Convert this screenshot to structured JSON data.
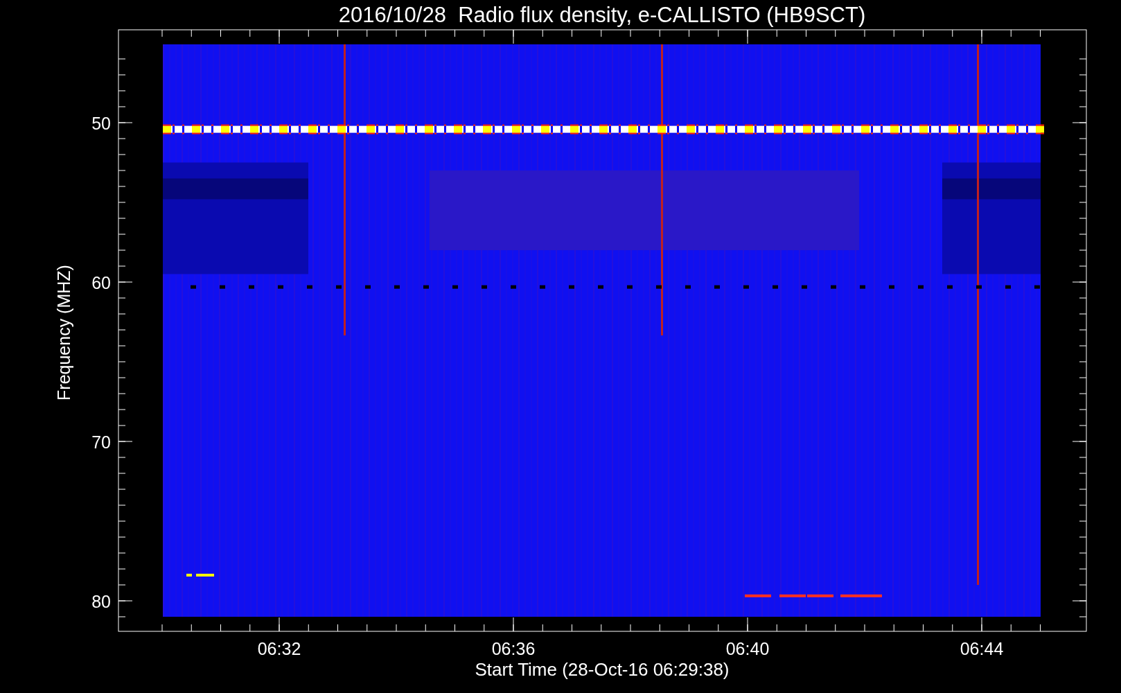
{
  "title": "2016/10/28  Radio flux density, e-CALLISTO (HB9SCT)",
  "y_axis": {
    "label": "Frequency (MHZ)",
    "ticks": [
      "50",
      "60",
      "70",
      "80"
    ]
  },
  "x_axis": {
    "label": "Start Time (28-Oct-16 06:29:38)",
    "ticks": [
      "06:32",
      "06:36",
      "06:40",
      "06:44"
    ]
  }
}
